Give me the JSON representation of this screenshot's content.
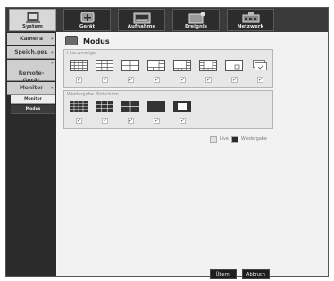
{
  "top_tabs": [
    {
      "label": "System",
      "icon": "system-icon",
      "active": true
    },
    {
      "label": "Gerät",
      "icon": "device-icon",
      "active": false
    },
    {
      "label": "Aufnahme",
      "icon": "record-icon",
      "active": false
    },
    {
      "label": "Ereignis",
      "icon": "event-icon",
      "active": false
    },
    {
      "label": "Netzwerk",
      "icon": "network-icon",
      "active": false
    }
  ],
  "sidebar": {
    "categories": [
      {
        "label": "Kamera"
      },
      {
        "label": "Speich.ger."
      },
      {
        "label": "Remote-\nGerät"
      },
      {
        "label": "Monitor"
      }
    ],
    "sub_items": [
      {
        "label": "Monitor",
        "selected": false
      },
      {
        "label": "Modus",
        "selected": true
      }
    ]
  },
  "page": {
    "title": "Modus",
    "live_group": {
      "label": "Live-Anzeige",
      "icons": [
        "grid-4x4-icon",
        "grid-3x3-icon",
        "grid-2x2-icon",
        "grid-1plus5-icon",
        "grid-1plus7-icon",
        "grid-1plus12-icon",
        "single-view-icon",
        "sequence-icon"
      ],
      "checks": [
        "✓",
        "✓",
        "✓",
        "✓",
        "✓",
        "✓",
        "✓",
        "✓"
      ]
    },
    "playback_group": {
      "label": "Wiedergabe Bildschirm",
      "icons": [
        "pb-grid-4x4-icon",
        "pb-grid-3x3-icon",
        "pb-grid-2x2-icon",
        "pb-single-icon",
        "pb-single-alt-icon"
      ],
      "checks": [
        "✓",
        "✓",
        "✓",
        "✓",
        "✓"
      ]
    },
    "legend": {
      "live": "Live",
      "playback": "Wiedergabe",
      "live_color": "#e0e0e0",
      "playback_color": "#2a2a2a"
    },
    "buttons": {
      "ok": "Übern.",
      "cancel": "Abbruch"
    }
  }
}
